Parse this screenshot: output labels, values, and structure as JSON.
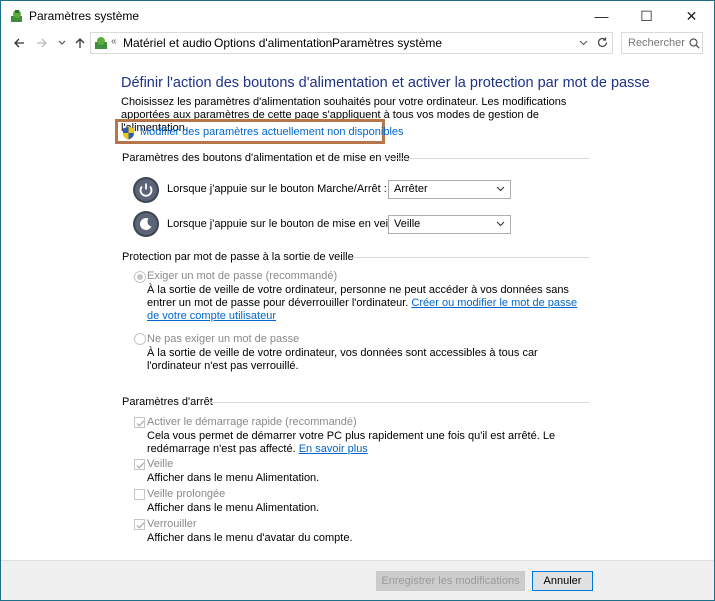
{
  "window": {
    "title": "Paramètres système",
    "minimize_glyph": "—",
    "maximize_glyph": "☐",
    "close_glyph": "✕"
  },
  "address_bar": {
    "overflow_glyph": "«",
    "breadcrumbs": [
      "Matériel et audio",
      "Options d'alimentation",
      "Paramètres système"
    ],
    "search_placeholder": "Rechercher"
  },
  "main": {
    "heading": "Définir l'action des boutons d'alimentation et activer la protection par mot de passe",
    "description": "Choisissez les paramètres d'alimentation souhaités pour votre ordinateur. Les modifications apportées aux paramètres de cette page s'appliquent à tous vos modes de gestion de l'alimentation.",
    "modify_link": "Modifier des paramètres actuellement non disponibles"
  },
  "power_buttons": {
    "section_title": "Paramètres des boutons d'alimentation et de mise en veille",
    "power_label": "Lorsque j'appuie sur le bouton Marche/Arrêt :",
    "power_value": "Arrêter",
    "sleep_label": "Lorsque j'appuie sur le bouton de mise en veille :",
    "sleep_value": "Veille"
  },
  "password": {
    "section_title": "Protection par mot de passe à la sortie de veille",
    "require_label": "Exiger un mot de passe (recommandé)",
    "require_desc_1": "À la sortie de veille de votre ordinateur, personne ne peut accéder à vos données sans entrer un mot de passe pour déverrouiller l'ordinateur.",
    "require_link": "Créer ou modifier le mot de passe de votre compte utilisateur",
    "no_require_label": "Ne pas exiger un mot de passe",
    "no_require_desc": "À la sortie de veille de votre ordinateur, vos données sont accessibles à tous car l'ordinateur n'est pas verrouillé."
  },
  "shutdown": {
    "section_title": "Paramètres d'arrêt",
    "fast_startup_label": "Activer le démarrage rapide (recommandé)",
    "fast_startup_desc": "Cela vous permet de démarrer votre PC plus rapidement une fois qu'il est arrêté. Le redémarrage n'est pas affecté.",
    "learn_more": "En savoir plus",
    "sleep_label": "Veille",
    "sleep_desc": "Afficher dans le menu Alimentation.",
    "hibernate_label": "Veille prolongée",
    "hibernate_desc": "Afficher dans le menu Alimentation.",
    "lock_label": "Verrouiller",
    "lock_desc": "Afficher dans le menu d'avatar du compte."
  },
  "footer": {
    "save_label": "Enregistrer les modifications",
    "cancel_label": "Annuler"
  },
  "colors": {
    "heading": "#1e3287",
    "link": "#0066cc",
    "highlight_border": "#b5774a"
  }
}
